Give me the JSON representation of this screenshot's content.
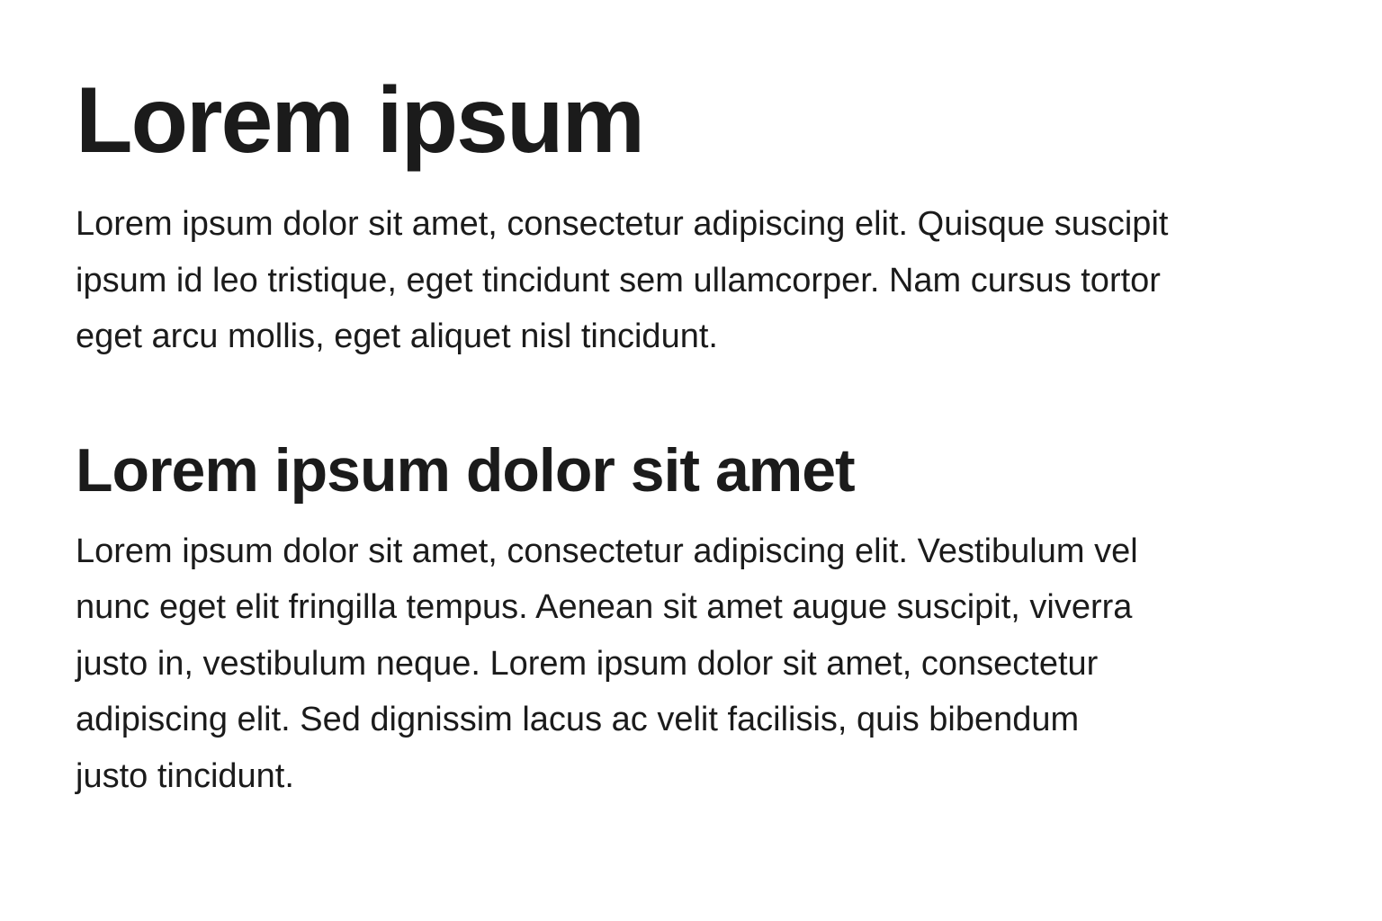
{
  "document": {
    "title": "Lorem ipsum",
    "paragraph_1": {
      "lines": [
        "Lorem ipsum dolor sit amet, consectetur adipiscing elit. Quisque suscipit",
        "ipsum id leo tristique, eget tincidunt sem ullamcorper. Nam cursus tortor",
        "eget arcu mollis, eget aliquet nisl tincidunt."
      ]
    },
    "section_heading": "Lorem ipsum dolor sit amet",
    "paragraph_2": {
      "lines": [
        "Lorem ipsum dolor sit amet, consectetur adipiscing elit. Vestibulum vel",
        "nunc eget elit fringilla tempus. Aenean sit amet augue suscipit, viverra",
        "justo in, vestibulum neque. Lorem ipsum dolor sit amet, consectetur",
        "adipiscing elit. Sed dignissim lacus ac velit facilisis, quis bibendum",
        "justo tincidunt."
      ]
    }
  },
  "colors": {
    "background": "#ffffff",
    "text": "#1b1b1b"
  }
}
